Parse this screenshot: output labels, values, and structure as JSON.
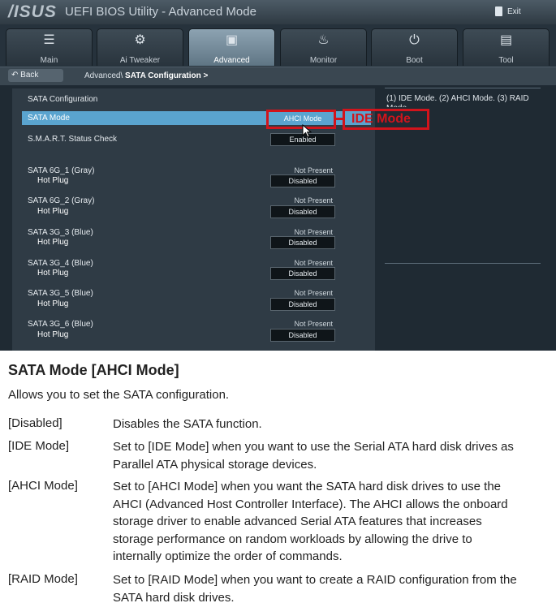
{
  "titlebar": {
    "logo": "/ISUS",
    "app_title": "UEFI BIOS Utility - Advanced Mode",
    "exit_label": "Exit"
  },
  "tabs": [
    {
      "label": "Main",
      "icon": "list-icon"
    },
    {
      "label": "Ai  Tweaker",
      "icon": "tweaker-icon"
    },
    {
      "label": "Advanced",
      "icon": "advanced-icon"
    },
    {
      "label": "Monitor",
      "icon": "monitor-icon"
    },
    {
      "label": "Boot",
      "icon": "power-icon"
    },
    {
      "label": "Tool",
      "icon": "tool-icon"
    }
  ],
  "active_tab": "Advanced",
  "breadcrumb": {
    "back_label": "Back",
    "path": "Advanced\\",
    "current": "SATA Configuration >"
  },
  "section_title": "SATA Configuration",
  "settings": {
    "sata_mode": {
      "label": "SATA Mode",
      "value": "AHCI Mode"
    },
    "smart": {
      "label": "S.M.A.R.T. Status Check",
      "value": "Enabled"
    }
  },
  "ports": [
    {
      "label": "SATA 6G_1 (Gray)",
      "status": "Not Present",
      "sub_label": "Hot Plug",
      "value": "Disabled"
    },
    {
      "label": "SATA 6G_2 (Gray)",
      "status": "Not Present",
      "sub_label": "Hot Plug",
      "value": "Disabled"
    },
    {
      "label": "SATA 3G_3 (Blue)",
      "status": "Not Present",
      "sub_label": "Hot Plug",
      "value": "Disabled"
    },
    {
      "label": "SATA 3G_4 (Blue)",
      "status": "Not Present",
      "sub_label": "Hot Plug",
      "value": "Disabled"
    },
    {
      "label": "SATA 3G_5 (Blue)",
      "status": "Not Present",
      "sub_label": "Hot Plug",
      "value": "Disabled"
    },
    {
      "label": "SATA 3G_6 (Blue)",
      "status": "Not Present",
      "sub_label": "Hot Plug",
      "value": "Disabled"
    }
  ],
  "help_text": "(1) IDE Mode. (2) AHCI Mode. (3) RAID Mode",
  "annotation": {
    "label": "IDE Mode",
    "color": "#d1141c"
  },
  "colors": {
    "selection": "#5aa4cf",
    "active_tab": "#7a91a0"
  },
  "doc": {
    "title": "SATA Mode [AHCI Mode]",
    "intro": "Allows you to set the SATA configuration.",
    "options": [
      {
        "name": "[Disabled]",
        "lines": [
          "Disables the SATA function."
        ]
      },
      {
        "name": "[IDE Mode]",
        "lines": [
          "Set to [IDE Mode] when you want to use the Serial ATA hard disk drives as",
          "Parallel ATA physical storage devices."
        ]
      },
      {
        "name": "[AHCI Mode]",
        "lines": [
          "Set to [AHCI Mode] when you want the SATA hard disk drives to use the",
          "AHCI (Advanced Host Controller Interface). The AHCI allows the onboard",
          "storage driver to enable advanced Serial ATA features that increases",
          "storage performance on random workloads by allowing the drive to",
          "internally optimize the order of commands."
        ]
      },
      {
        "name": "[RAID Mode]",
        "lines": [
          "Set to [RAID Mode] when you want to create a RAID configuration from the",
          "SATA hard disk drives."
        ]
      }
    ]
  }
}
